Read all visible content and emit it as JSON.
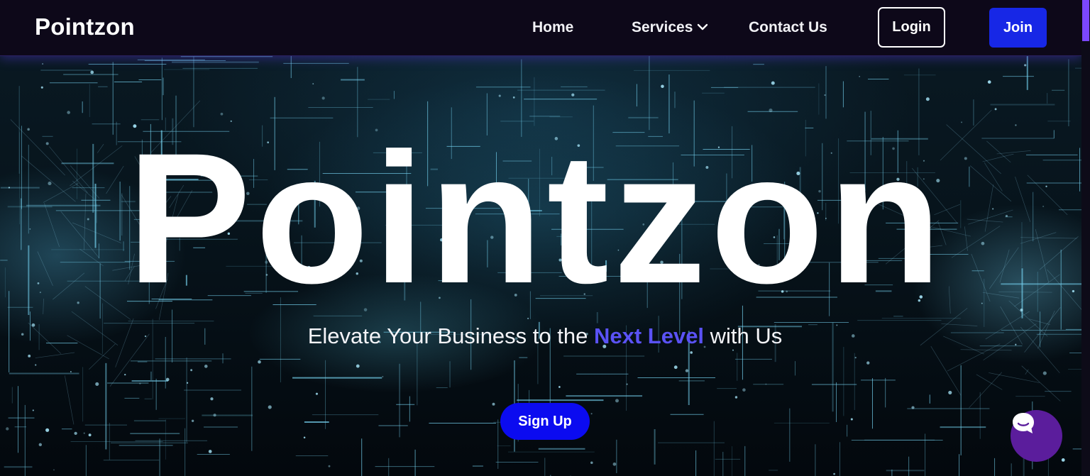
{
  "navbar": {
    "brand": "Pointzon",
    "links": [
      {
        "label": "Home"
      },
      {
        "label": "Services",
        "icon": "chevron-down-icon"
      },
      {
        "label": "Contact Us"
      }
    ],
    "login_label": "Login",
    "join_label": "Join"
  },
  "hero": {
    "title": "Pointzon",
    "tagline_before": "Elevate Your Business to the ",
    "tagline_accent": "Next Level",
    "tagline_after": " with Us",
    "cta_label": "Sign Up"
  },
  "chat_widget": {
    "icon": "chat-bubble-icon"
  },
  "colors": {
    "navbar_bg": "#0d0819",
    "join_button": "#1727e6",
    "signup_button": "#0b0bf0",
    "tagline_accent": "#5a52f5",
    "chat_bubble": "#5b1d9c",
    "scroll_thumb": "#7b47ff"
  }
}
